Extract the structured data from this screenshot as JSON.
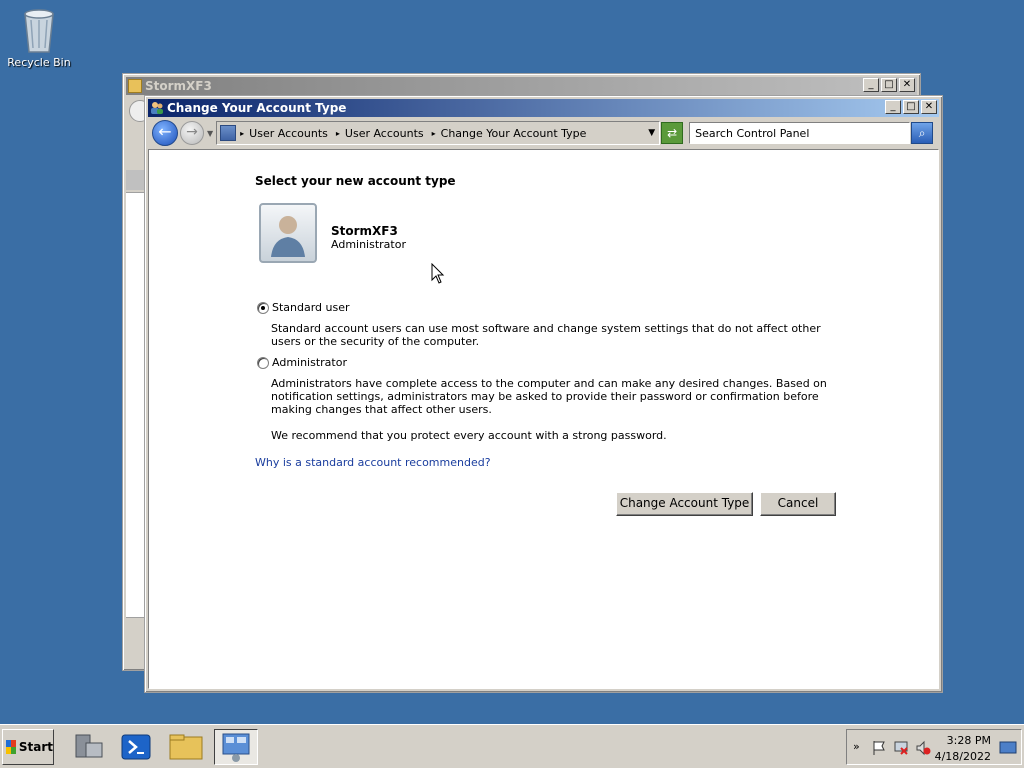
{
  "desktop": {
    "recycle_bin_label": "Recycle Bin"
  },
  "background_window": {
    "title": "StormXF3",
    "minimize": "_",
    "maximize": "□",
    "close": "✕"
  },
  "dialog": {
    "title": "Change Your Account Type",
    "minimize": "_",
    "maximize": "□",
    "close": "✕",
    "breadcrumbs": [
      "User Accounts",
      "User Accounts",
      "Change Your Account Type"
    ],
    "search_placeholder": "Search Control Panel",
    "heading": "Select your new account type",
    "account": {
      "name": "StormXF3",
      "type": "Administrator"
    },
    "options": [
      {
        "label": "Standard user",
        "selected": true,
        "description": "Standard account users can use most software and change system settings that do not affect other users or the security of the computer."
      },
      {
        "label": "Administrator",
        "selected": false,
        "description": "Administrators have complete access to the computer and can make any desired changes. Based on notification settings, administrators may be asked to provide their password or confirmation before making changes that affect other users."
      }
    ],
    "recommendation": "We recommend that you protect every account with a strong password.",
    "help_link": "Why is a standard account recommended?",
    "change_button": "Change Account Type",
    "cancel_button": "Cancel"
  },
  "taskbar": {
    "start_label": "Start",
    "clock_time": "3:28 PM",
    "clock_date": "4/18/2022",
    "tray_expand": "»"
  }
}
